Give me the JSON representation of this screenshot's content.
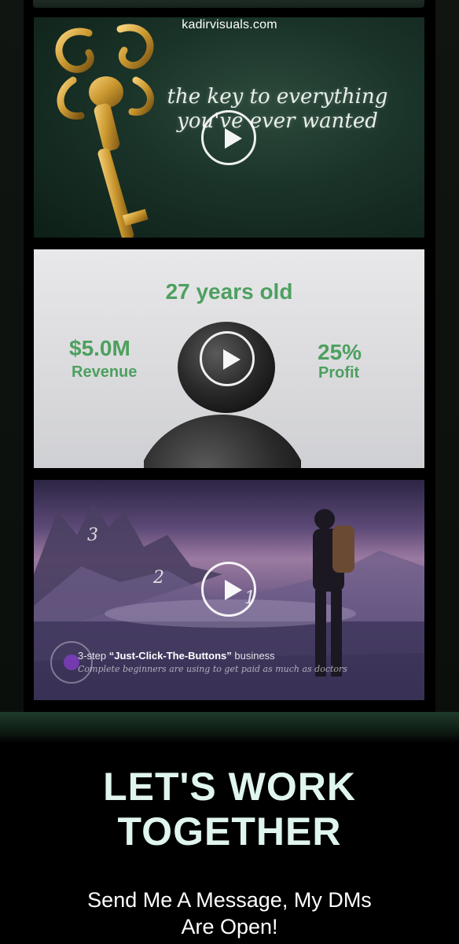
{
  "header": {
    "domain": "kadirvisuals.com"
  },
  "videos": [
    {
      "headline_line1": "the key to everything",
      "headline_line2": "you've ever wanted"
    },
    {
      "age": "27 years old",
      "revenue_value": "$5.0M",
      "revenue_label": "Revenue",
      "profit_value": "25%",
      "profit_label": "Profit"
    },
    {
      "steps": [
        "3",
        "2",
        "1"
      ],
      "title_prefix": "3-step ",
      "title_bold": "“Just-Click-The-Buttons”",
      "title_suffix": " business",
      "subtitle": "Complete beginners are using to get paid as much as doctors"
    }
  ],
  "cta": {
    "heading_line1": "LET'S WORK",
    "heading_line2": "TOGETHER",
    "subtext_line1": "Send Me A Message, My DMs",
    "subtext_line2": "Are Open!"
  },
  "colors": {
    "background": "#000000",
    "accent_green": "#4da05f",
    "heading_mint": "#dff5ee"
  },
  "icons": [
    "play-icon",
    "key-icon"
  ]
}
